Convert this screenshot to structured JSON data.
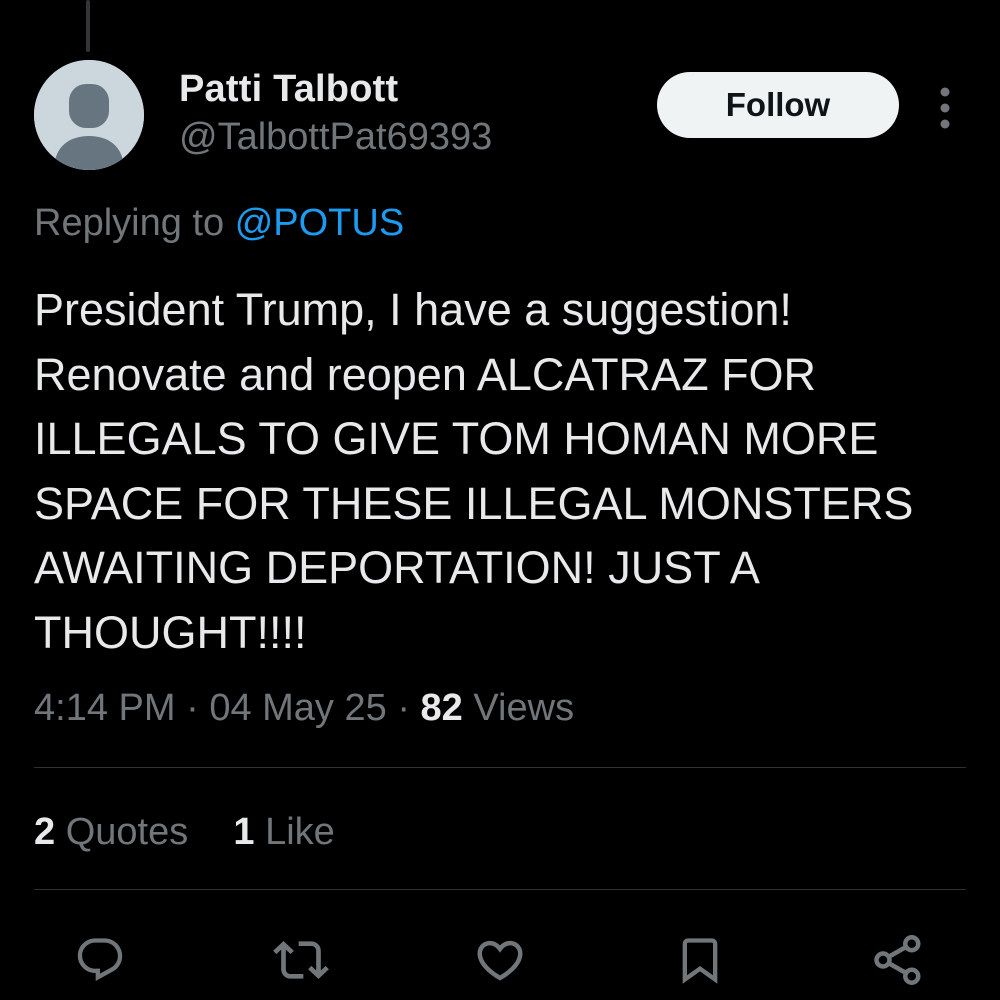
{
  "tweet": {
    "display_name": "Patti Talbott",
    "handle": "@TalbottPat69393",
    "follow_label": "Follow",
    "replying_prefix": "Replying to",
    "replying_mention": "@POTUS",
    "text": "President Trump, I have a suggestion!\nRenovate and reopen ALCATRAZ FOR\nILLEGALS TO GIVE TOM HOMAN MORE\nSPACE FOR THESE ILLEGAL MONSTERS\nAWAITING DEPORTATION! JUST A\nTHOUGHT!!!!",
    "time": "4:14 PM",
    "separator": "·",
    "date": "04 May 25",
    "views_count": "82",
    "views_label": "Views"
  },
  "stats": {
    "quotes_count": "2",
    "quotes_label": "Quotes",
    "likes_count": "1",
    "likes_label": "Like"
  },
  "actions": {
    "icons": [
      "reply-icon",
      "retweet-icon",
      "like-icon",
      "bookmark-icon",
      "share-icon"
    ]
  },
  "colors": {
    "background": "#000000",
    "text_primary": "#e7e9ea",
    "text_secondary": "#71767b",
    "accent": "#1d9bf0",
    "divider": "#2f3336",
    "follow_bg": "#eff3f4"
  }
}
